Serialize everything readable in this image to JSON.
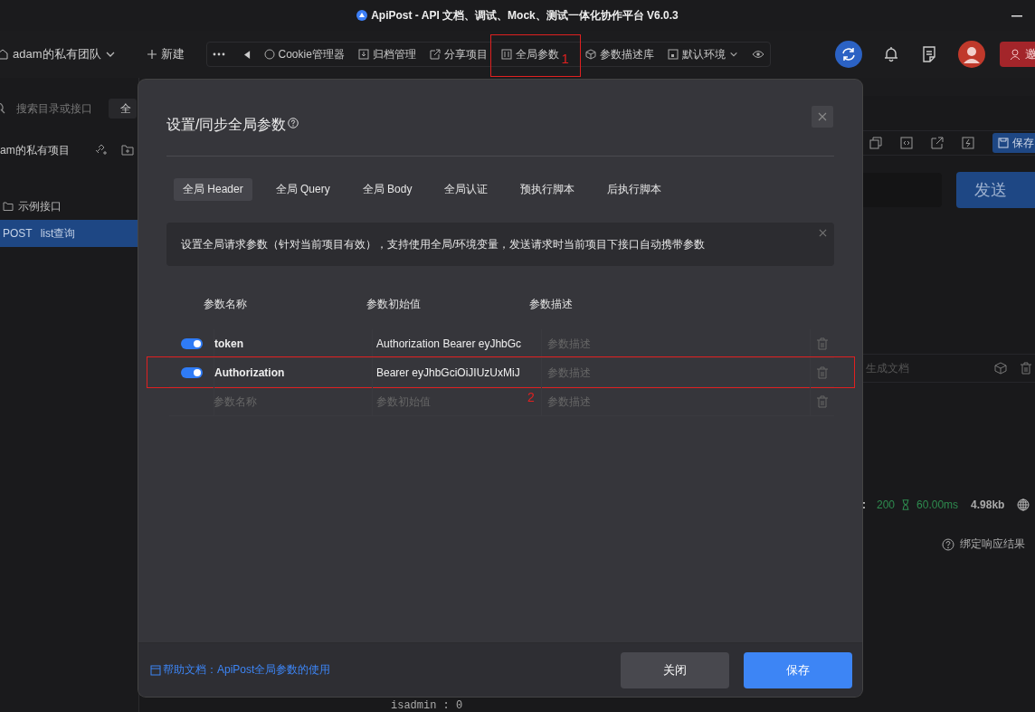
{
  "window": {
    "title": "ApiPost - API 文档、调试、Mock、测试一体化协作平台 V6.0.3"
  },
  "toolbar": {
    "team": "adam的私有团队",
    "new": "新建",
    "items": [
      {
        "label": "Cookie管理器"
      },
      {
        "label": "归档管理"
      },
      {
        "label": "分享项目"
      },
      {
        "label": "全局参数",
        "marker": "1"
      },
      {
        "label": "参数描述库"
      }
    ],
    "environment": "默认环境",
    "invite": "邀"
  },
  "sidebar": {
    "search_placeholder": "搜索目录或接口",
    "filter": "全",
    "project": "am的私有项目",
    "tree": [
      {
        "kind": "folder",
        "label": "示例接口",
        "selected": false
      },
      {
        "kind": "api",
        "method": "POST",
        "label": "list查询",
        "selected": true
      }
    ]
  },
  "main": {
    "save": "保存",
    "send": "发送",
    "doc_placeholder": "生成文档",
    "status_label": ":",
    "status_code": "200",
    "time": "60.00ms",
    "size": "4.98kb",
    "bind_hint": "绑定响应结果",
    "code_line": "isadmin : 0"
  },
  "modal": {
    "title": "设置/同步全局参数",
    "tabs": [
      {
        "label": "全局 Header",
        "selected": true
      },
      {
        "label": "全局 Query",
        "selected": false
      },
      {
        "label": "全局 Body",
        "selected": false
      },
      {
        "label": "全局认证",
        "selected": false
      },
      {
        "label": "预执行脚本",
        "selected": false
      },
      {
        "label": "后执行脚本",
        "selected": false
      }
    ],
    "notice": "设置全局请求参数（针对当前项目有效），支持使用全局/环境变量，发送请求时当前项目下接口自动携带参数",
    "columns": [
      "参数名称",
      "参数初始值",
      "参数描述"
    ],
    "rows": [
      {
        "kind": "param",
        "enabled": true,
        "name": "token",
        "value": "Authorization Bearer eyJhbGc",
        "description_placeholder": "参数描述"
      },
      {
        "kind": "param",
        "enabled": true,
        "name": "Authorization",
        "value": "Bearer eyJhbGciOiJIUzUxMiJ",
        "description_placeholder": "参数描述",
        "marker": "2"
      },
      {
        "kind": "new",
        "name_placeholder": "参数名称",
        "value_placeholder": "参数初始值",
        "description_placeholder": "参数描述"
      }
    ],
    "help_link": "帮助文档：ApiPost全局参数的使用",
    "buttons": [
      {
        "label": "关闭",
        "kind": "secondary"
      },
      {
        "label": "保存",
        "kind": "primary"
      }
    ]
  }
}
